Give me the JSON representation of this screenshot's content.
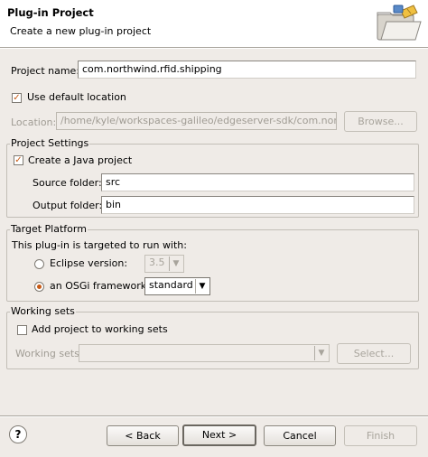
{
  "header": {
    "title": "Plug-in Project",
    "subtitle": "Create a new plug-in project"
  },
  "project_name": {
    "label": "Project name:",
    "value": "com.northwind.rfid.shipping"
  },
  "use_default_location": {
    "label": "Use default location",
    "checked": true
  },
  "location": {
    "label": "Location:",
    "value": "/home/kyle/workspaces-galileo/edgeserver-sdk/com.northwind",
    "browse_label": "Browse..."
  },
  "project_settings": {
    "title": "Project Settings",
    "java_project": {
      "label": "Create a Java project",
      "checked": true
    },
    "source_folder": {
      "label": "Source folder:",
      "value": "src"
    },
    "output_folder": {
      "label": "Output folder:",
      "value": "bin"
    }
  },
  "target_platform": {
    "title": "Target Platform",
    "description": "This plug-in is targeted to run with:",
    "eclipse_version": {
      "label": "Eclipse version:",
      "value": "3.5",
      "selected": false
    },
    "osgi_framework": {
      "label": "an OSGi framework:",
      "value": "standard",
      "selected": true
    }
  },
  "working_sets": {
    "title": "Working sets",
    "add_to_sets": {
      "label": "Add project to working sets",
      "checked": false
    },
    "sets_label": "Working sets:",
    "sets_value": "",
    "select_label": "Select..."
  },
  "footer": {
    "help_symbol": "?",
    "back_label": "< Back",
    "next_label": "Next >",
    "cancel_label": "Cancel",
    "finish_label": "Finish"
  }
}
